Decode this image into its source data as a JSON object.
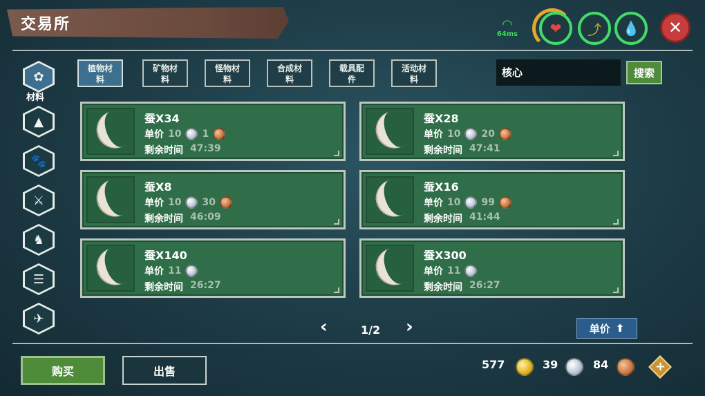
{
  "header": {
    "title": "交易所",
    "ping": "64ms",
    "close_icon": "x-icon"
  },
  "status_icons": [
    "heart-icon",
    "food-icon",
    "water-drop-icon"
  ],
  "sidebar": {
    "active_label": "材料",
    "items": [
      {
        "icon": "materials-icon"
      },
      {
        "icon": "camp-icon"
      },
      {
        "icon": "paw-icon"
      },
      {
        "icon": "weapon-icon"
      },
      {
        "icon": "horse-icon"
      },
      {
        "icon": "scroll-icon"
      },
      {
        "icon": "bird-icon"
      }
    ]
  },
  "tabs": [
    {
      "line1": "植物材",
      "line2": "料",
      "active": true
    },
    {
      "line1": "矿物材",
      "line2": "料",
      "active": false
    },
    {
      "line1": "怪物材",
      "line2": "料",
      "active": false
    },
    {
      "line1": "合成材",
      "line2": "料",
      "active": false
    },
    {
      "line1": "载具配",
      "line2": "件",
      "active": false
    },
    {
      "line1": "活动材",
      "line2": "料",
      "active": false
    }
  ],
  "search": {
    "value": "核心",
    "button_label": "搜索"
  },
  "listings": [
    {
      "name": "蚕X34",
      "price_label": "单价",
      "silver": "10",
      "copper": "1",
      "time_label": "剩余时间",
      "time": "47:39"
    },
    {
      "name": "蚕X28",
      "price_label": "单价",
      "silver": "10",
      "copper": "20",
      "time_label": "剩余时间",
      "time": "47:41"
    },
    {
      "name": "蚕X8",
      "price_label": "单价",
      "silver": "10",
      "copper": "30",
      "time_label": "剩余时间",
      "time": "46:09"
    },
    {
      "name": "蚕X16",
      "price_label": "单价",
      "silver": "10",
      "copper": "99",
      "time_label": "剩余时间",
      "time": "41:44"
    },
    {
      "name": "蚕X140",
      "price_label": "单价",
      "silver": "11",
      "copper": "",
      "time_label": "剩余时间",
      "time": "26:27"
    },
    {
      "name": "蚕X300",
      "price_label": "单价",
      "silver": "11",
      "copper": "",
      "time_label": "剩余时间",
      "time": "26:27"
    }
  ],
  "pagination": {
    "page": "1/2",
    "prev_icon": "chevron-left-icon",
    "next_icon": "chevron-right-icon"
  },
  "sort": {
    "label": "单价",
    "icon": "arrow-up-icon"
  },
  "actions": {
    "buy": "购买",
    "sell": "出售"
  },
  "wallet": {
    "gold": "577",
    "silver": "39",
    "copper": "84"
  },
  "colors": {
    "card_green": "#2f6e48",
    "button_green": "#4f8c3a",
    "active_tab": "#3d6f8e",
    "ping_green": "#3ddc54"
  }
}
